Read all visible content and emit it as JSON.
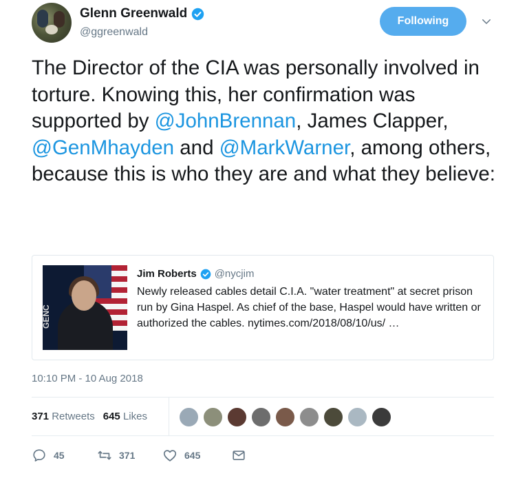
{
  "author": {
    "name": "Glenn Greenwald",
    "handle": "@ggreenwald"
  },
  "follow_button": {
    "label": "Following"
  },
  "tweet": {
    "segments": [
      {
        "text": "The Director of the CIA was personally involved in torture. Knowing this, her confirmation was supported by ",
        "type": "text"
      },
      {
        "text": "@JohnBrennan",
        "type": "mention"
      },
      {
        "text": ", James Clapper, ",
        "type": "text"
      },
      {
        "text": "@GenMhayden",
        "type": "mention"
      },
      {
        "text": " and ",
        "type": "text"
      },
      {
        "text": "@MarkWarner",
        "type": "mention"
      },
      {
        "text": ", among others, because this is who they are and what they believe:",
        "type": "text"
      }
    ]
  },
  "quoted_tweet": {
    "name": "Jim Roberts",
    "handle": "@nycjim",
    "text": "Newly released cables detail C.I.A. \"water treatment\" at secret prison run by Gina Haspel. As chief of the base, Haspel would have written or authorized the cables. nytimes.com/2018/08/10/us/ …",
    "image_caption_fragment": "GENC"
  },
  "timestamp": "10:10 PM - 10 Aug 2018",
  "stats": {
    "retweets_count": "371",
    "retweets_label": "Retweets",
    "likes_count": "645",
    "likes_label": "Likes"
  },
  "likers": [
    {
      "color": "#9aa9b6"
    },
    {
      "color": "#8c8f7a"
    },
    {
      "color": "#5b3a32"
    },
    {
      "color": "#6d6d6d"
    },
    {
      "color": "#7a5a4a"
    },
    {
      "color": "#8d8d8d"
    },
    {
      "color": "#4c4a3a"
    },
    {
      "color": "#aab8c2"
    },
    {
      "color": "#3b3b3b"
    }
  ],
  "actions": {
    "reply_count": "45",
    "retweet_count": "371",
    "like_count": "645"
  },
  "colors": {
    "accent": "#1b95e0",
    "follow_button_bg": "#55acee",
    "muted": "#657786"
  }
}
